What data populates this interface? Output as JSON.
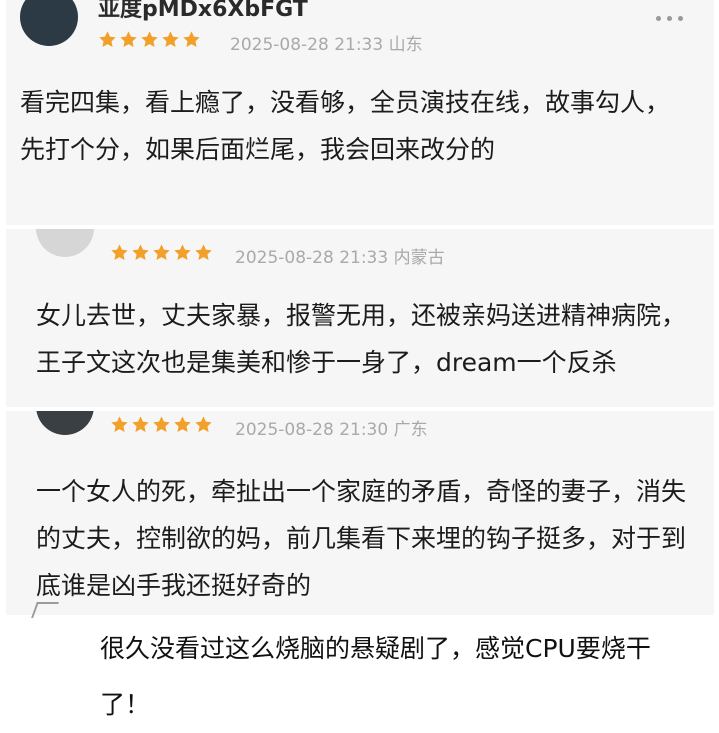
{
  "colors": {
    "star": "#f2a02a",
    "meta": "#a9a9a9",
    "card": "#f6f6f6"
  },
  "comments": [
    {
      "username": "亚度pMDx6XbFGT",
      "stars": 5,
      "meta": "2025-08-28 21:33 山东",
      "text": "看完四集，看上瘾了，没看够，全员演技在线，故事勾人，先打个分，如果后面烂尾，我会回来改分的"
    },
    {
      "stars": 5,
      "meta": "2025-08-28 21:33 内蒙古",
      "text": "女儿去世，丈夫家暴，报警无用，还被亲妈送进精神病院，王子文这次也是集美和惨于一身了，dream一个反杀"
    },
    {
      "stars": 5,
      "meta": "2025-08-28 21:30 广东",
      "text": "一个女人的死，牵扯出一个家庭的矛盾，奇怪的妻子，消失的丈夫，控制欲的妈，前几集看下来埋的钩子挺多，对于到底谁是凶手我还挺好奇的"
    }
  ],
  "caption": "很久没看过这么烧脑的悬疑剧了，感觉CPU要烧干了！"
}
